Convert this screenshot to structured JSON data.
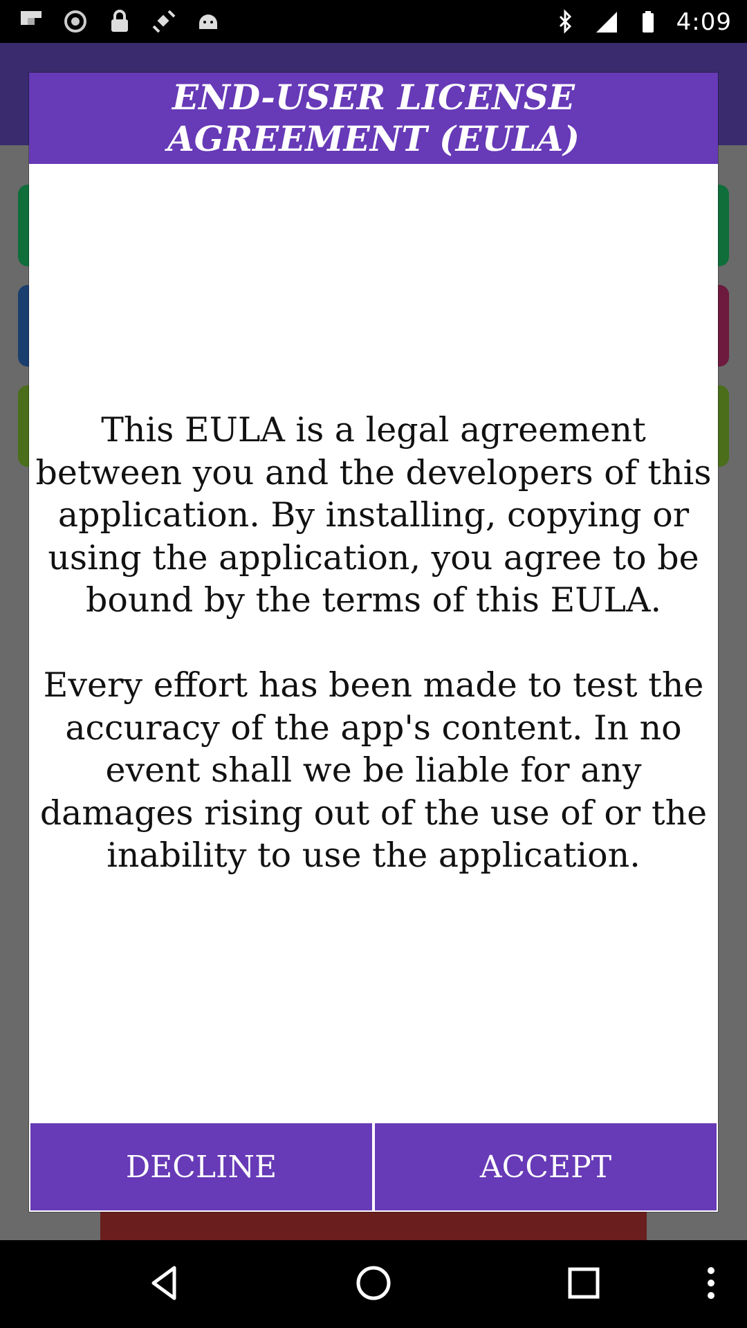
{
  "status_bar": {
    "time": "4:09",
    "left_icons": [
      "flipboard-icon",
      "sync-icon",
      "lock-icon",
      "fake-gps-icon",
      "android-icon"
    ],
    "right_icons": [
      "bluetooth-icon",
      "signal-icon",
      "battery-icon"
    ]
  },
  "dialog": {
    "title": "END-USER LICENSE AGREEMENT (EULA)",
    "paragraph_1": "This EULA is a legal agreement between you and the developers of this application. By installing, copying or using the application, you agree to be bound by the terms of this EULA.",
    "paragraph_2": "Every effort has been made to test the accuracy of the app's content. In no event shall we be liable for any damages rising out of the use of or the inability to use the application.",
    "decline_label": "DECLINE",
    "accept_label": "ACCEPT"
  },
  "colors": {
    "accent": "#673ab7",
    "background_dim": "#6a6a6a",
    "app_bar": "#392b6e"
  },
  "nav_bar": {
    "icons": [
      "back-icon",
      "home-icon",
      "recents-icon",
      "menu-icon"
    ]
  }
}
